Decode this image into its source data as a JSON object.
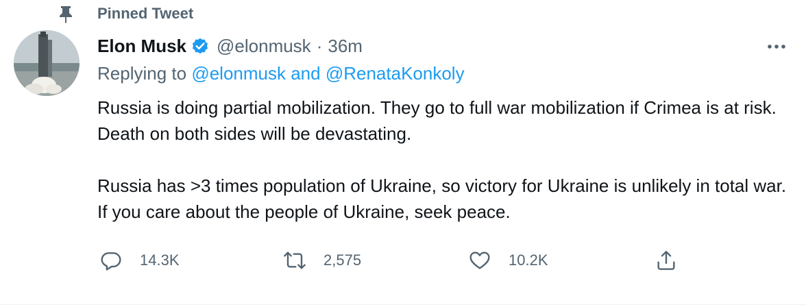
{
  "pinned": {
    "label": "Pinned Tweet",
    "icon": "pin-icon"
  },
  "author": {
    "display_name": "Elon Musk",
    "handle": "@elonmusk",
    "separator": "·",
    "timestamp": "36m",
    "verified": true
  },
  "reply": {
    "prefix": "Replying to",
    "mention1": "@elonmusk",
    "conjunction": "and",
    "mention2": "@RenataKonkoly"
  },
  "body": {
    "paragraph1": "Russia is doing partial mobilization. They go to full war mobilization if Crimea is at risk. Death on both sides will be devastating.",
    "paragraph2": "Russia has >3 times population of Ukraine, so victory for Ukraine is unlikely in total war. If you care about the people of Ukraine, seek peace."
  },
  "actions": {
    "reply_count": "14.3K",
    "retweet_count": "2,575",
    "like_count": "10.2K"
  },
  "colors": {
    "accent": "#1d9bf0",
    "secondary_text": "#536471",
    "primary_text": "#0f1419"
  }
}
